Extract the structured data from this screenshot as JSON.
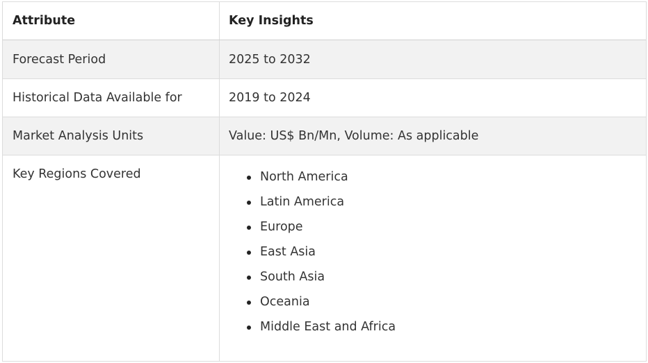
{
  "table": {
    "header": {
      "col1": "Attribute",
      "col2": "Key Insights"
    },
    "rows": [
      {
        "attribute": "Forecast Period",
        "insight": "2025 to 2032"
      },
      {
        "attribute": "Historical Data Available for",
        "insight": "2019 to 2024"
      },
      {
        "attribute": "Market Analysis Units",
        "insight": "Value: US$ Bn/Mn, Volume: As applicable"
      },
      {
        "attribute": "Key Regions Covered"
      }
    ],
    "regions": [
      "North America",
      "Latin America",
      "Europe",
      "East Asia",
      "South Asia",
      "Oceania",
      "Middle East and Africa"
    ]
  },
  "colors": {
    "shaded_row": "#f2f2f2",
    "border": "#dcdcdc",
    "text": "#333333"
  }
}
